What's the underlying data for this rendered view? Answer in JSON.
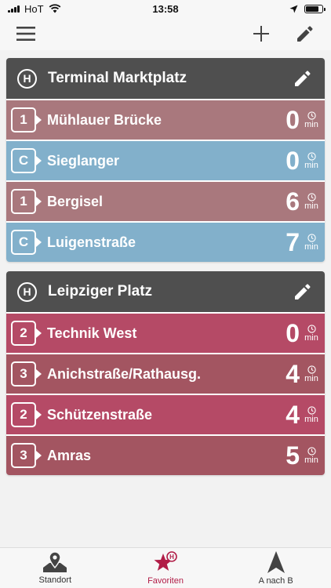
{
  "statusbar": {
    "carrier": "HoT",
    "time": "13:58",
    "battery_fraction": 0.8
  },
  "colors": {
    "header": "#4f4f4f",
    "line1": "#a9787d",
    "lineC": "#82b0cb",
    "line2": "#b54a66",
    "line3": "#a35561",
    "accent": "#b11d47"
  },
  "toolbar": {
    "menu_icon": "hamburger-icon",
    "add_icon": "plus-icon",
    "edit_icon": "pencil-icon"
  },
  "favorites": [
    {
      "title": "Terminal Marktplatz",
      "badge": "H",
      "departures": [
        {
          "line": "1",
          "stop": "Mühlauer Brücke",
          "minutes": "0",
          "unit": "min",
          "color": "#a9787d"
        },
        {
          "line": "C",
          "stop": "Sieglanger",
          "minutes": "0",
          "unit": "min",
          "color": "#82b0cb"
        },
        {
          "line": "1",
          "stop": "Bergisel",
          "minutes": "6",
          "unit": "min",
          "color": "#a9787d"
        },
        {
          "line": "C",
          "stop": "Luigenstraße",
          "minutes": "7",
          "unit": "min",
          "color": "#82b0cb"
        }
      ]
    },
    {
      "title": "Leipziger Platz",
      "badge": "H",
      "departures": [
        {
          "line": "2",
          "stop": "Technik West",
          "minutes": "0",
          "unit": "min",
          "color": "#b54a66"
        },
        {
          "line": "3",
          "stop": "Anichstraße/Rathausg.",
          "minutes": "4",
          "unit": "min",
          "color": "#a35561"
        },
        {
          "line": "2",
          "stop": "Schützenstraße",
          "minutes": "4",
          "unit": "min",
          "color": "#b54a66"
        },
        {
          "line": "3",
          "stop": "Amras",
          "minutes": "5",
          "unit": "min",
          "color": "#a35561"
        }
      ]
    }
  ],
  "tabbar": {
    "tabs": [
      {
        "label": "Standort",
        "icon": "map-pin-icon",
        "active": false
      },
      {
        "label": "Favoriten",
        "icon": "star-h-icon",
        "active": true
      },
      {
        "label": "A nach B",
        "icon": "navigation-arrow-icon",
        "active": false
      }
    ]
  }
}
